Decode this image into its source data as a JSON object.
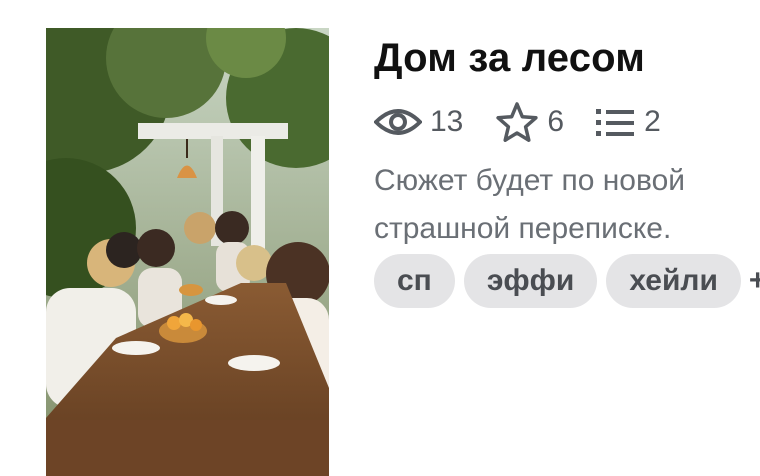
{
  "story": {
    "title": "Дом за лесом",
    "description": "Сюжет будет по новой страшной переписке."
  },
  "stats": {
    "views": {
      "icon": "eye-icon",
      "value": "13"
    },
    "stars": {
      "icon": "star-icon",
      "value": "6"
    },
    "parts": {
      "icon": "list-icon",
      "value": "2"
    }
  },
  "tags": [
    "сп",
    "эффи",
    "хейли"
  ],
  "tags_more_label": "+",
  "cover": {
    "alt": "cover-image"
  },
  "colors": {
    "title": "#111111",
    "meta": "#555a60",
    "tag_bg": "#e4e4e6"
  }
}
